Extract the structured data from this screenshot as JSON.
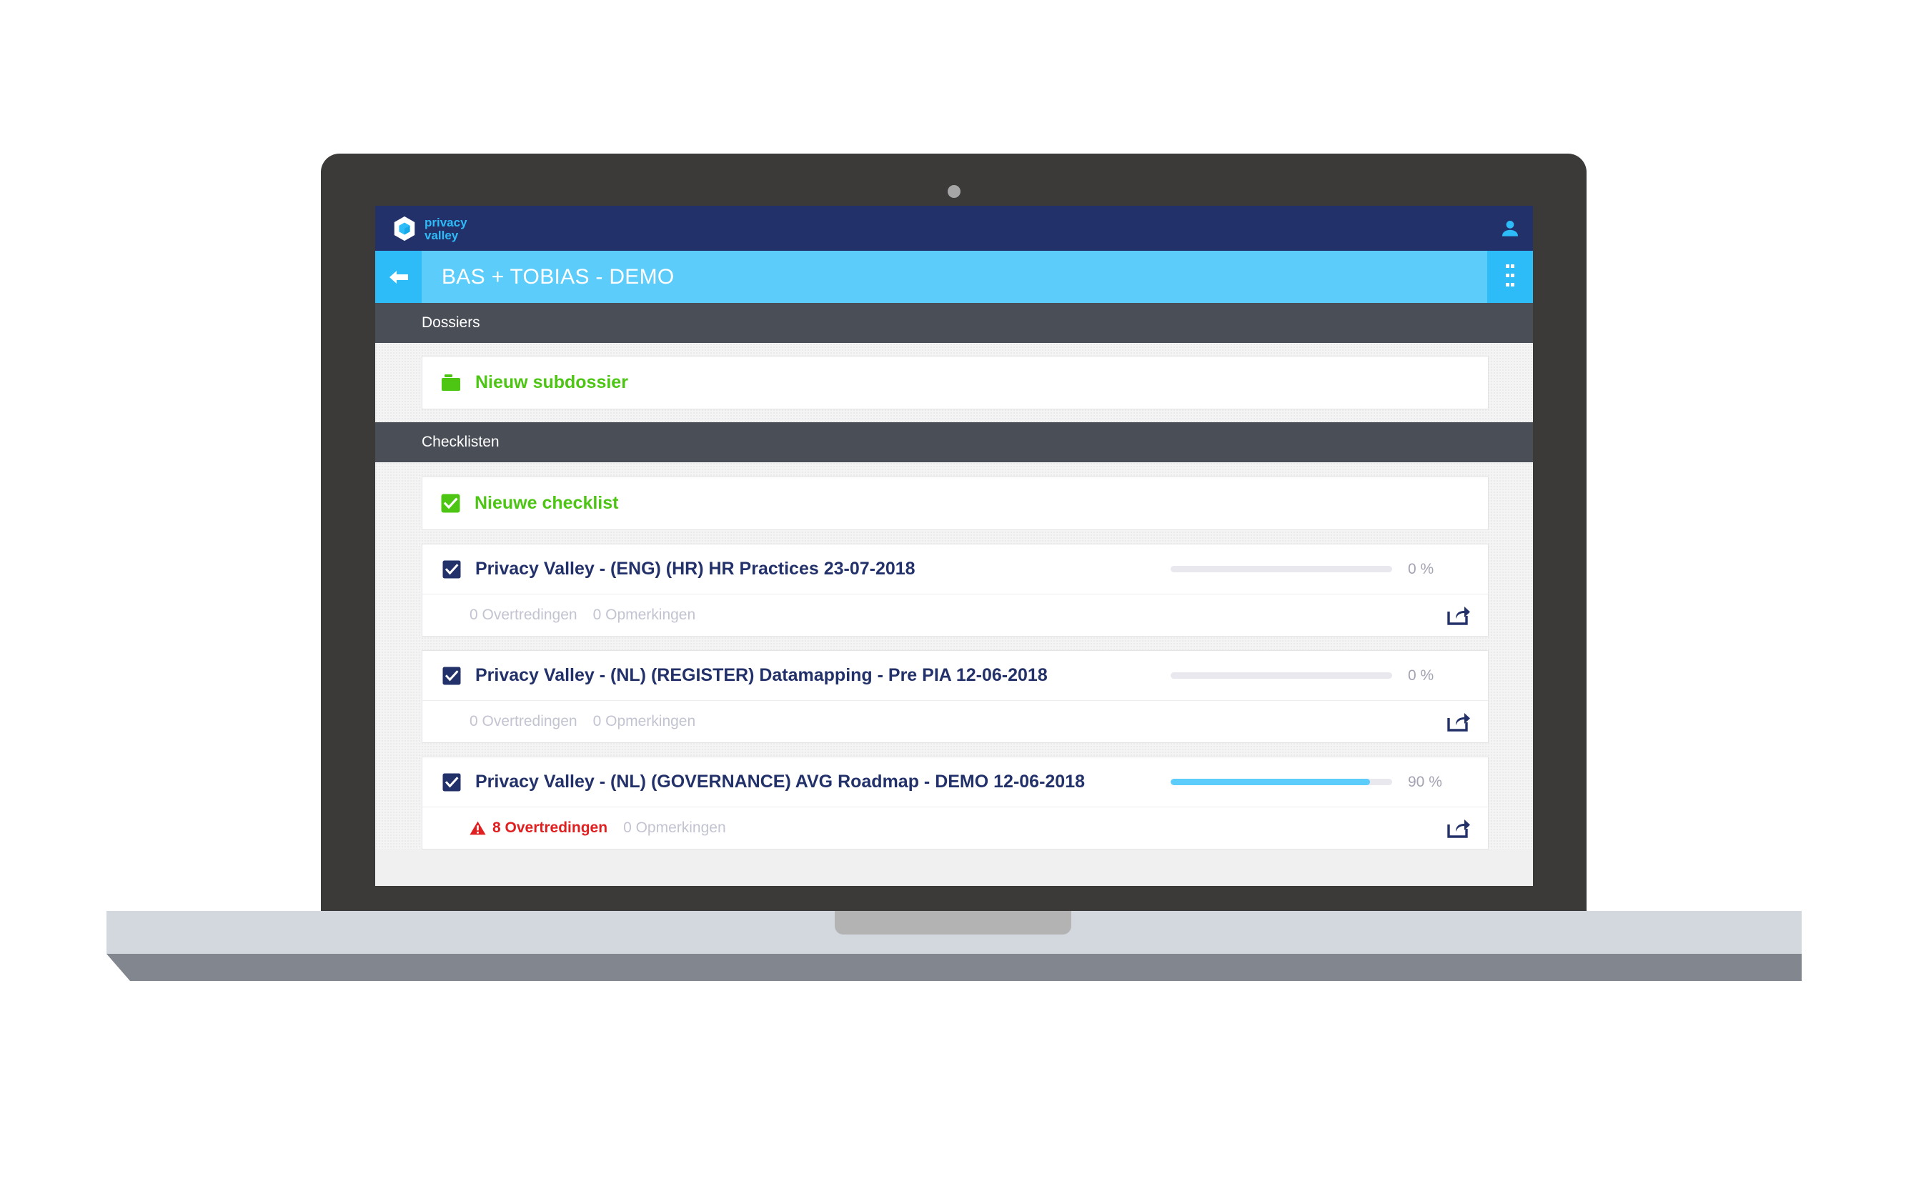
{
  "brand": {
    "name": "privacy valley",
    "line1": "privacy",
    "line2": "valley"
  },
  "navbar": {
    "user_icon": "user-icon"
  },
  "titlebar": {
    "back_icon": "arrow-left-icon",
    "title": "BAS + TOBIAS - DEMO",
    "menu_icon": "grid-dots-icon"
  },
  "sections": {
    "dossiers": {
      "header": "Dossiers",
      "create": {
        "label": "Nieuw subdossier",
        "icon": "folder-icon"
      }
    },
    "checklisten": {
      "header": "Checklisten",
      "create": {
        "label": "Nieuwe checklist",
        "icon": "green-check-icon"
      }
    }
  },
  "checklists": [
    {
      "title": "Privacy Valley - (ENG) (HR) HR Practices 23-07-2018",
      "checked": true,
      "progress": 0,
      "progress_label": "0 %",
      "violations": "0 Overtredingen",
      "violations_alert": false,
      "remarks": "0 Opmerkingen",
      "share_icon": "share-icon"
    },
    {
      "title": "Privacy Valley - (NL) (REGISTER) Datamapping - Pre PIA 12-06-2018",
      "checked": true,
      "progress": 0,
      "progress_label": "0 %",
      "violations": "0 Overtredingen",
      "violations_alert": false,
      "remarks": "0 Opmerkingen",
      "share_icon": "share-icon"
    },
    {
      "title": "Privacy Valley - (NL) (GOVERNANCE) AVG Roadmap - DEMO 12-06-2018",
      "checked": true,
      "progress": 90,
      "progress_label": "90 %",
      "violations": "8 Overtredingen",
      "violations_alert": true,
      "remarks": "0 Opmerkingen",
      "share_icon": "share-icon"
    }
  ],
  "colors": {
    "navy": "#23316a",
    "cyan": "#5ccdfb",
    "cyan_dark": "#2dbcf8",
    "green": "#4cc513",
    "red": "#e02020",
    "section_gray": "#4a4e57",
    "muted": "#c3c4d1"
  }
}
